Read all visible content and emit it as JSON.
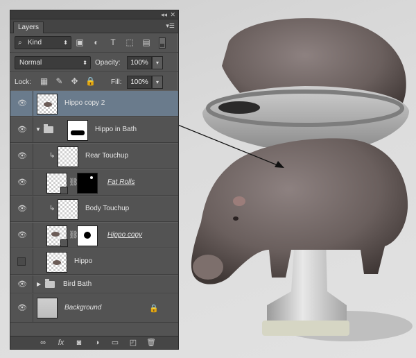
{
  "panel": {
    "tab": "Layers",
    "collapse_icon": "double-chevron-left-icon",
    "close_icon": "close-icon",
    "menu_icon": "panel-menu-icon"
  },
  "filter": {
    "kind_label": "Kind",
    "icons": [
      "image-filter-icon",
      "adjustment-filter-icon",
      "type-filter-icon",
      "shape-filter-icon",
      "smart-object-filter-icon"
    ]
  },
  "blend": {
    "mode": "Normal",
    "opacity_label": "Opacity:",
    "opacity": "100%",
    "lock_label": "Lock:",
    "fill_label": "Fill:",
    "fill": "100%"
  },
  "layers": [
    {
      "name": "Hippo copy 2",
      "visible": true,
      "selected": true
    },
    {
      "name": "Hippo in Bath",
      "visible": true,
      "type": "group",
      "expanded": true
    },
    {
      "name": "Rear Touchup",
      "visible": true,
      "clipped": true
    },
    {
      "name": "Fat Rolls",
      "visible": true,
      "linked_mask": true
    },
    {
      "name": "Body Touchup",
      "visible": true,
      "clipped": true
    },
    {
      "name": "Hippo copy",
      "visible": true,
      "linked_mask": true
    },
    {
      "name": "Hippo",
      "visible": false
    },
    {
      "name": "Bird Bath",
      "visible": true,
      "type": "group",
      "expanded": false
    },
    {
      "name": "Background",
      "visible": true,
      "locked": true
    }
  ],
  "footer_icons": [
    "link-layers-icon",
    "fx-icon",
    "add-mask-icon",
    "adjustment-layer-icon",
    "new-group-icon",
    "new-layer-icon",
    "trash-icon"
  ],
  "colors": {
    "panel_bg": "#535353",
    "selected_row": "#6a7b8c",
    "hippo_skin": "#6e625f"
  }
}
